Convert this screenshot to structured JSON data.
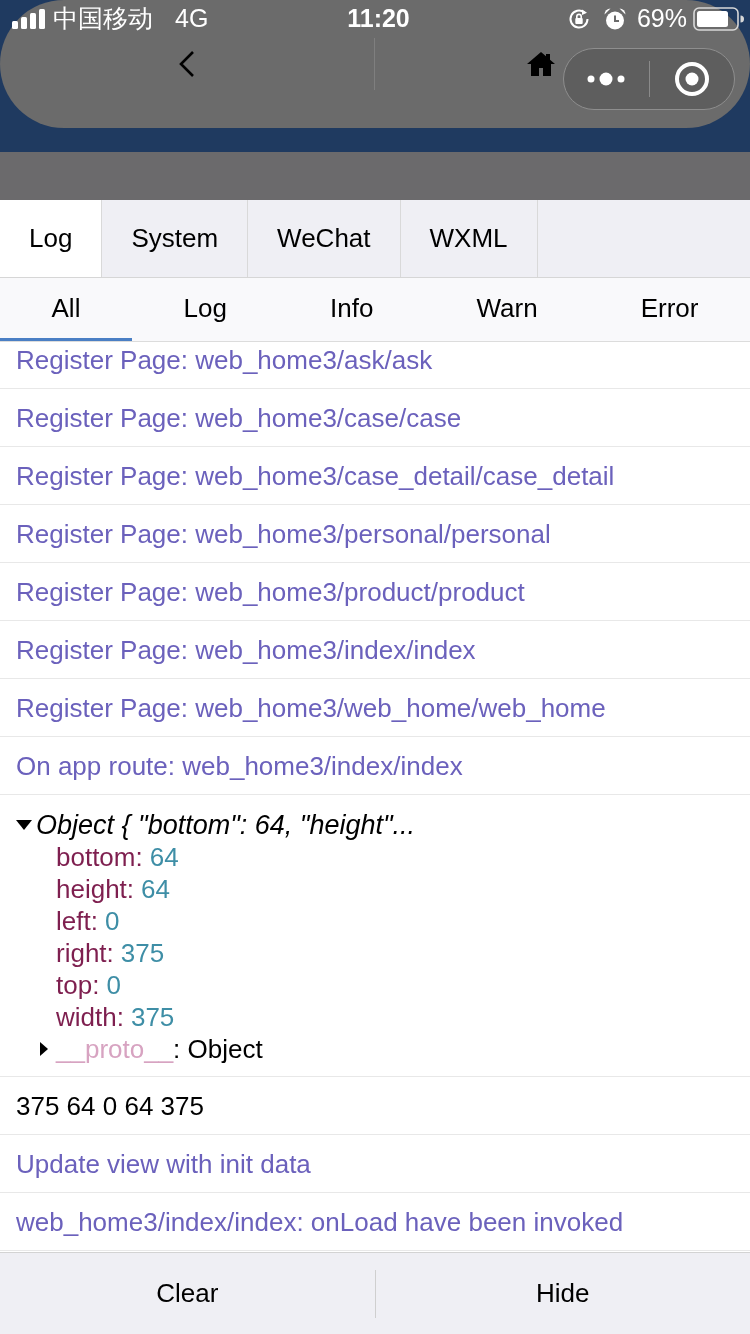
{
  "status_bar": {
    "carrier": "中国移动",
    "network": "4G",
    "time": "11:20",
    "battery": "69%"
  },
  "tabs": [
    {
      "label": "Log",
      "selected": true
    },
    {
      "label": "System",
      "selected": false
    },
    {
      "label": "WeChat",
      "selected": false
    },
    {
      "label": "WXML",
      "selected": false
    }
  ],
  "filters": [
    {
      "label": "All",
      "selected": true
    },
    {
      "label": "Log",
      "selected": false
    },
    {
      "label": "Info",
      "selected": false
    },
    {
      "label": "Warn",
      "selected": false
    },
    {
      "label": "Error",
      "selected": false
    }
  ],
  "log_entries": [
    {
      "kind": "info",
      "text": "Register Page: web_home3/ask/ask"
    },
    {
      "kind": "info",
      "text": "Register Page: web_home3/case/case"
    },
    {
      "kind": "info",
      "text": "Register Page: web_home3/case_detail/case_detail"
    },
    {
      "kind": "info",
      "text": "Register Page: web_home3/personal/personal"
    },
    {
      "kind": "info",
      "text": "Register Page: web_home3/product/product"
    },
    {
      "kind": "info",
      "text": "Register Page: web_home3/index/index"
    },
    {
      "kind": "info",
      "text": "Register Page: web_home3/web_home/web_home"
    },
    {
      "kind": "info",
      "text": "On app route: web_home3/index/index"
    },
    {
      "kind": "object",
      "summary": "Object { \"bottom\": 64, \"height\"...",
      "expanded": true,
      "properties": [
        {
          "key": "bottom:",
          "value": "64"
        },
        {
          "key": "height:",
          "value": "64"
        },
        {
          "key": "left:",
          "value": "0"
        },
        {
          "key": "right:",
          "value": "375"
        },
        {
          "key": "top:",
          "value": "0"
        },
        {
          "key": "width:",
          "value": "375"
        }
      ],
      "proto": {
        "key": "__proto__",
        "value": ": Object",
        "expanded": false
      }
    },
    {
      "kind": "log",
      "text": "375 64 0 64 375"
    },
    {
      "kind": "info",
      "text": "Update view with init data"
    },
    {
      "kind": "info",
      "text": "web_home3/index/index: onLoad have been invoked"
    }
  ],
  "buttons": [
    {
      "label": "Clear"
    },
    {
      "label": "Hide"
    }
  ]
}
